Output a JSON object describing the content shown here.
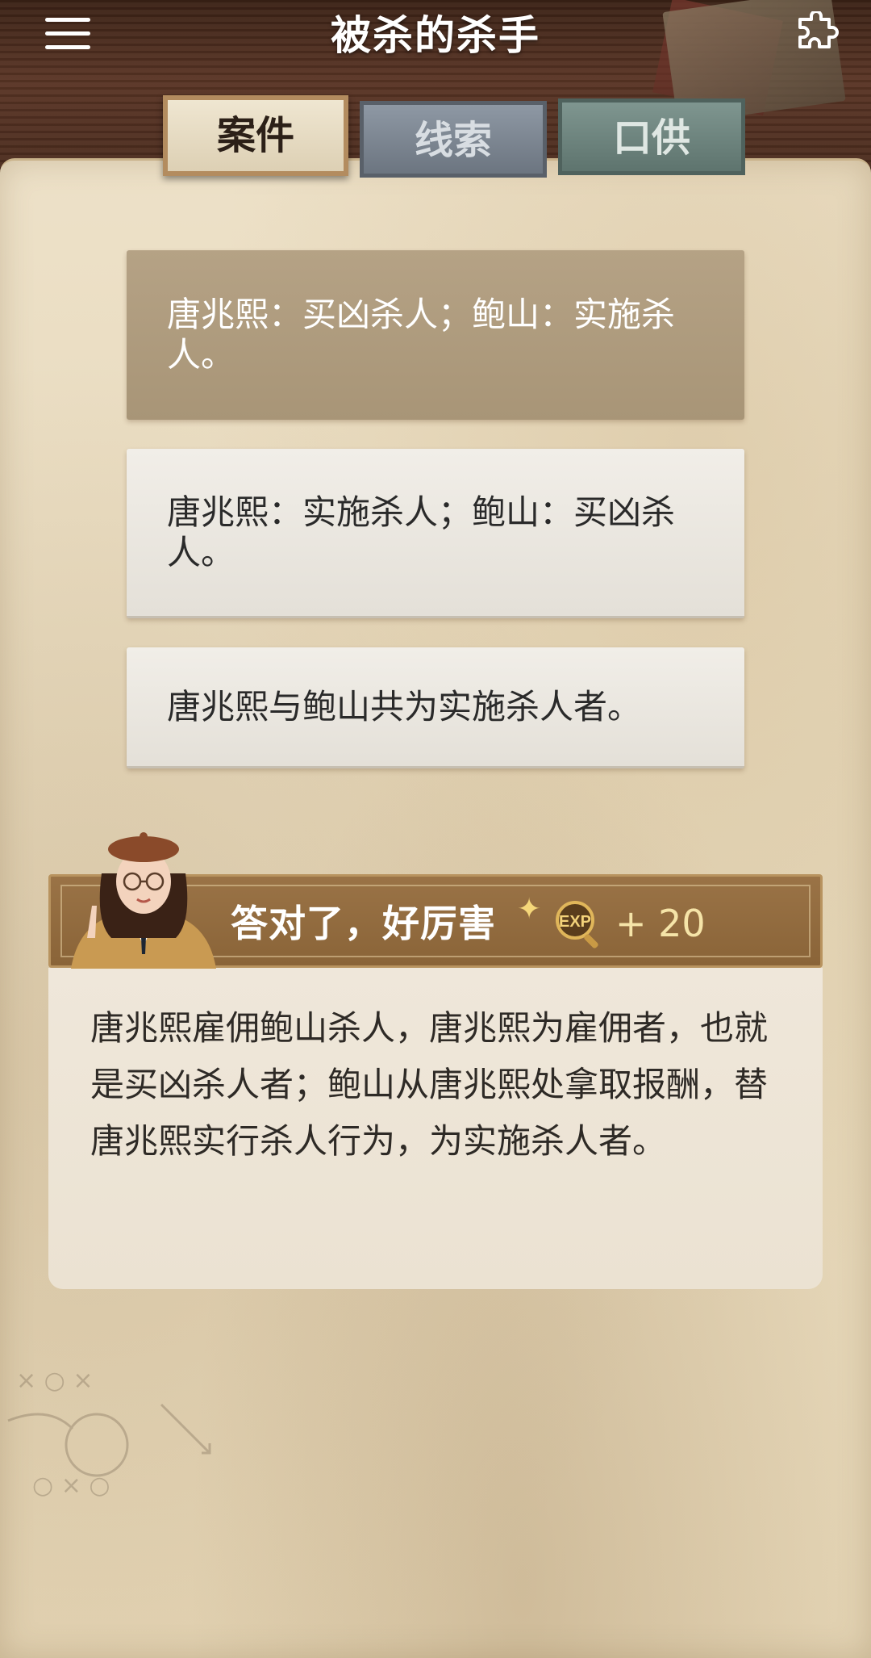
{
  "header": {
    "title": "被杀的杀手",
    "menu_icon": "hamburger-menu-icon",
    "puzzle_icon": "puzzle-piece-icon"
  },
  "tabs": [
    {
      "label": "案件",
      "active": true
    },
    {
      "label": "线索",
      "active": false
    },
    {
      "label": "口供",
      "active": false
    }
  ],
  "options": [
    {
      "text": "唐兆熙：买凶杀人；鲍山：实施杀人。",
      "selected": true
    },
    {
      "text": "唐兆熙：实施杀人；鲍山：买凶杀人。",
      "selected": false
    },
    {
      "text": "唐兆熙与鲍山共为实施杀人者。",
      "selected": false
    }
  ],
  "result": {
    "message": "答对了，好厉害",
    "exp_label": "EXP",
    "exp_amount": "+ 20"
  },
  "explanation": "唐兆熙雇佣鲍山杀人，唐兆熙为雇佣者，也就是买凶杀人者；鲍山从唐兆熙处拿取报酬，替唐兆熙实行杀人行为，为实施杀人者。",
  "colors": {
    "selected_option_bg": "#b09b7d",
    "banner_bg": "#92693d",
    "paper_bg": "#e8dbc0"
  }
}
